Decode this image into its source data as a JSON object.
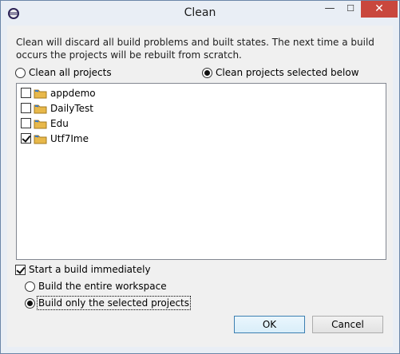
{
  "window": {
    "title": "Clean",
    "minimize_glyph": "—",
    "maximize_glyph": "☐",
    "close_glyph": "✕"
  },
  "description": "Clean will discard all build problems and built states.  The next time a build occurs the projects will be rebuilt from scratch.",
  "clean_scope": {
    "all_projects_label": "Clean all projects",
    "selected_projects_label": "Clean projects selected below",
    "selected": "selected_projects"
  },
  "projects": [
    {
      "name": "appdemo",
      "checked": false
    },
    {
      "name": "DailyTest",
      "checked": false
    },
    {
      "name": "Edu",
      "checked": false
    },
    {
      "name": "Utf7Ime",
      "checked": true
    }
  ],
  "build": {
    "start_label": "Start a build immediately",
    "start_checked": true,
    "entire_workspace_label": "Build the entire workspace",
    "selected_projects_label": "Build only the selected projects",
    "selected": "selected_projects"
  },
  "buttons": {
    "ok_label": "OK",
    "cancel_label": "Cancel"
  },
  "colors": {
    "close_button": "#c9473d",
    "title_bar": "#e9eef5",
    "folder": "#e8b84a"
  }
}
